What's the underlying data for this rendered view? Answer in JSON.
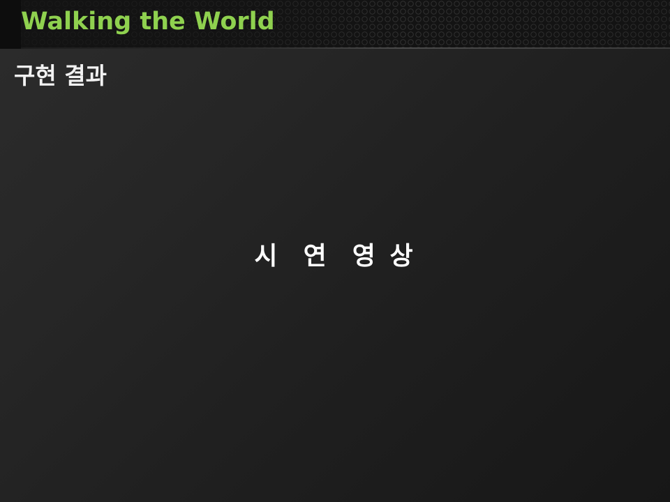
{
  "header": {
    "title": "Walking the World"
  },
  "section": {
    "title": "구현 결과"
  },
  "content": {
    "center_text": "시  연  영 상"
  },
  "colors": {
    "title_accent": "#8fd14f",
    "background": "#222222",
    "text": "#ffffff"
  }
}
